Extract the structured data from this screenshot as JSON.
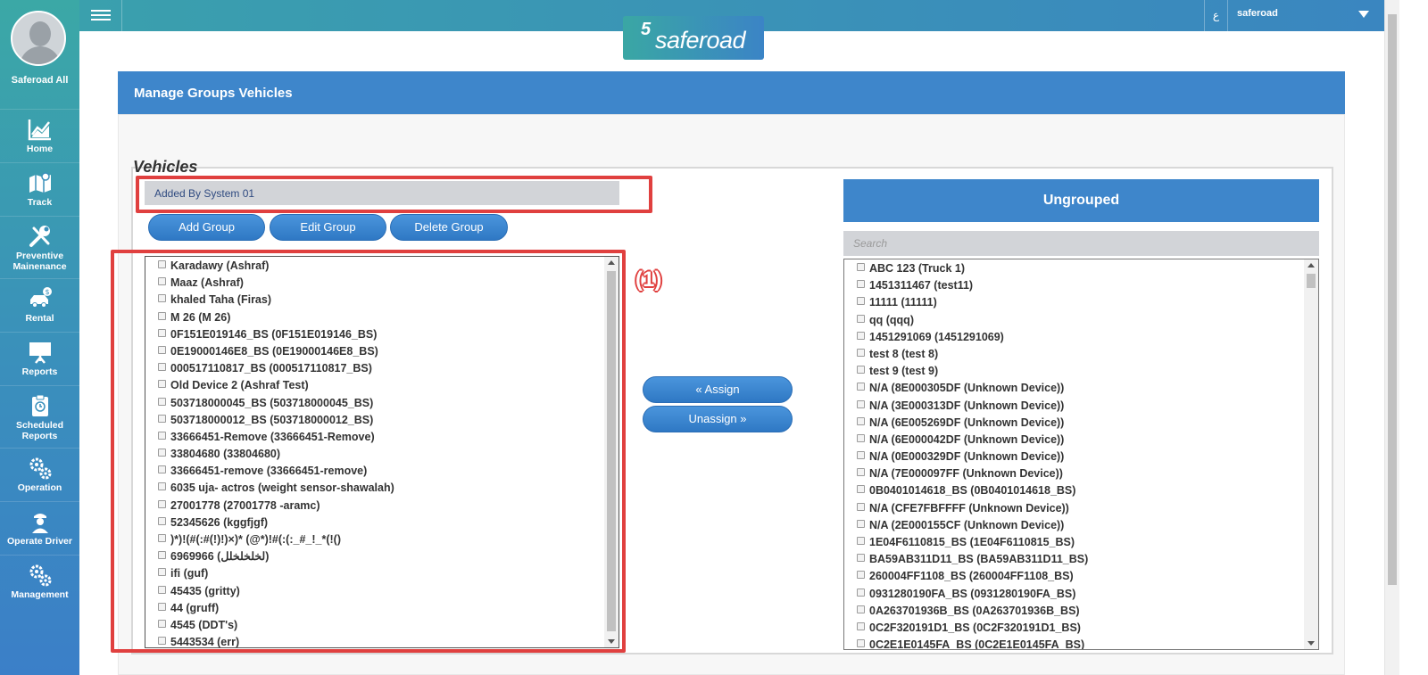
{
  "user": {
    "name": "Saferoad All"
  },
  "nav": [
    {
      "label": "Home",
      "icon": "chart-icon"
    },
    {
      "label": "Track",
      "icon": "map-icon"
    },
    {
      "label": "Preventive Mainenance",
      "icon": "wrench-screwdriver-icon"
    },
    {
      "label": "Rental",
      "icon": "car-dollar-icon"
    },
    {
      "label": "Reports",
      "icon": "presentation-board-icon"
    },
    {
      "label": "Scheduled Reports",
      "icon": "clipboard-icon"
    },
    {
      "label": "Operation",
      "icon": "gears-icon"
    },
    {
      "label": "Operate Driver",
      "icon": "driver-icon"
    },
    {
      "label": "Management",
      "icon": "gears-icon"
    }
  ],
  "topbar": {
    "lang": "ع",
    "account": "saferoad"
  },
  "logo": {
    "mark": "5",
    "text": "saferoad"
  },
  "panel": {
    "title": "Manage Groups Vehicles"
  },
  "vehicles": {
    "title": "Vehicles",
    "selected_group": "Added By System 01",
    "buttons": {
      "add": "Add Group",
      "edit": "Edit Group",
      "delete": "Delete Group"
    },
    "items": [
      "Karadawy (Ashraf)",
      "Maaz (Ashraf)",
      "khaled Taha (Firas)",
      "M 26 (M 26)",
      "0F151E019146_BS (0F151E019146_BS)",
      "0E19000146E8_BS (0E19000146E8_BS)",
      "000517110817_BS (000517110817_BS)",
      "Old Device 2 (Ashraf Test)",
      "503718000045_BS (503718000045_BS)",
      "503718000012_BS (503718000012_BS)",
      "33666451-Remove (33666451-Remove)",
      "33804680 (33804680)",
      "33666451-remove (33666451-remove)",
      "6035 uja- actros (weight sensor-shawalah)",
      "27001778 (27001778 -aramc)",
      "52345626 (kggfjgf)",
      ")*)!(#(:#(!)!)×)* (@*)!#(:(:_#_!_*(!()",
      "6969966 (لخلخلخلل)",
      "ifi (guf)",
      "45435 (gritty)",
      "44 (gruff)",
      "4545 (DDT's)",
      "5443534 (err)"
    ]
  },
  "actions": {
    "assign": "« Assign",
    "unassign": "Unassign »"
  },
  "ungrouped": {
    "title": "Ungrouped",
    "search_placeholder": "Search",
    "items": [
      "ABC 123 (Truck 1)",
      "1451311467 (test11)",
      "11111 (11111)",
      "qq (qqq)",
      "1451291069 (1451291069)",
      "test 8 (test 8)",
      "test 9 (test 9)",
      "N/A (8E000305DF (Unknown Device))",
      "N/A (3E000313DF (Unknown Device))",
      "N/A (6E005269DF (Unknown Device))",
      "N/A (6E000042DF (Unknown Device))",
      "N/A (0E000329DF (Unknown Device))",
      "N/A (7E000097FF (Unknown Device))",
      "0B0401014618_BS (0B0401014618_BS)",
      "N/A (CFE7FBFFFF (Unknown Device))",
      "N/A (2E000155CF (Unknown Device))",
      "1E04F6110815_BS (1E04F6110815_BS)",
      "BA59AB311D11_BS (BA59AB311D11_BS)",
      "260004FF1108_BS (260004FF1108_BS)",
      "0931280190FA_BS (0931280190FA_BS)",
      "0A263701936B_BS (0A263701936B_BS)",
      "0C2F320191D1_BS (0C2F320191D1_BS)",
      "0C2E1E0145FA_BS (0C2E1E0145FA_BS)"
    ]
  },
  "annotation": {
    "callout": "(1)"
  },
  "colors": {
    "accent": "#3e86cb",
    "highlight": "#e0403f",
    "sidebar_top": "#3ba8a6",
    "sidebar_bottom": "#3b7fc8"
  }
}
